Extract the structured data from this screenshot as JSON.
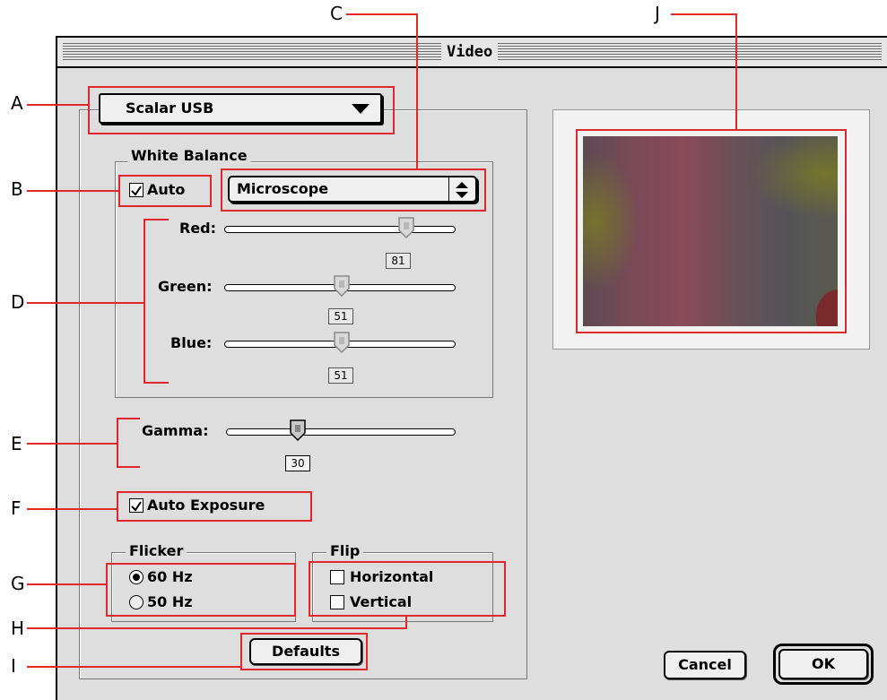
{
  "window": {
    "title": "Video"
  },
  "camera_select": {
    "value": "Scalar USB"
  },
  "white_balance": {
    "group_label": "White Balance",
    "auto_label": "Auto",
    "auto_checked": true,
    "preset_value": "Microscope",
    "sliders": [
      {
        "label": "Red:",
        "value": "81",
        "level": 81
      },
      {
        "label": "Green:",
        "value": "51",
        "level": 51
      },
      {
        "label": "Blue:",
        "value": "51",
        "level": 51
      }
    ]
  },
  "gamma": {
    "label": "Gamma:",
    "value": "30",
    "level": 30
  },
  "auto_exposure": {
    "label": "Auto Exposure",
    "checked": true
  },
  "flicker": {
    "group_label": "Flicker",
    "options": [
      {
        "label": "60 Hz",
        "selected": true
      },
      {
        "label": "50 Hz",
        "selected": false
      }
    ]
  },
  "flip": {
    "group_label": "Flip",
    "options": [
      {
        "label": "Horizontal",
        "checked": false
      },
      {
        "label": "Vertical",
        "checked": false
      }
    ]
  },
  "buttons": {
    "defaults": "Defaults",
    "cancel": "Cancel",
    "ok": "OK"
  },
  "callouts": [
    "A",
    "B",
    "C",
    "D",
    "E",
    "F",
    "G",
    "H",
    "I",
    "J"
  ],
  "colors": {
    "callout_red": "#e0282a"
  }
}
